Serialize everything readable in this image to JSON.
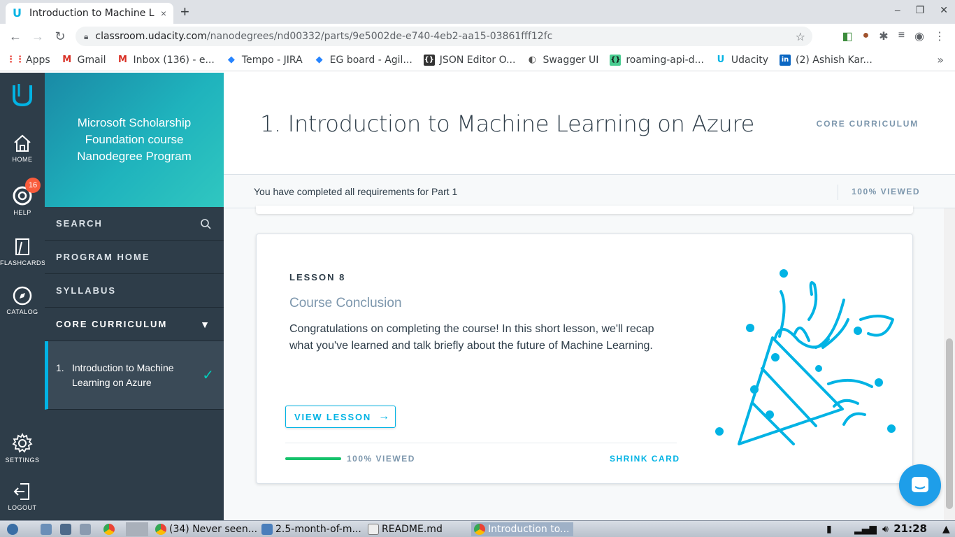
{
  "browser": {
    "tab_title": "Introduction to Machine L",
    "tab_close": "×",
    "new_tab": "+",
    "url_host": "classroom.udacity.com",
    "url_path": "/nanodegrees/nd00332/parts/9e5002de-e740-4eb2-aa15-03861fff12fc",
    "window_controls": [
      "–",
      "❐",
      "✕"
    ]
  },
  "bookmarks": [
    {
      "label": "Apps",
      "icon": "apps-grid-icon",
      "color": "#e8453c"
    },
    {
      "label": "Gmail",
      "icon": "gmail-icon",
      "color": "#d93025"
    },
    {
      "label": "Inbox (136) - e...",
      "icon": "gmail-icon",
      "color": "#d93025"
    },
    {
      "label": "Tempo - JIRA",
      "icon": "jira-icon",
      "color": "#2684ff"
    },
    {
      "label": "EG board - Agil...",
      "icon": "jira-icon",
      "color": "#2684ff"
    },
    {
      "label": "JSON Editor O...",
      "icon": "json-icon",
      "color": "#333333"
    },
    {
      "label": "Swagger UI",
      "icon": "swagger-icon",
      "color": "#555555"
    },
    {
      "label": "roaming-api-d...",
      "icon": "swagger-green-icon",
      "color": "#49cc90"
    },
    {
      "label": "Udacity",
      "icon": "udacity-icon",
      "color": "#02b3e4"
    },
    {
      "label": "(2) Ashish Kar...",
      "icon": "linkedin-icon",
      "color": "#0a66c2"
    }
  ],
  "rail": {
    "home": "HOME",
    "help": "HELP",
    "help_badge": "16",
    "flashcards": "FLASHCARDS",
    "catalog": "CATALOG",
    "settings": "SETTINGS",
    "logout": "LOGOUT"
  },
  "sidebar": {
    "program_title": "Microsoft Scholarship Foundation course Nanodegree Program",
    "search": "SEARCH",
    "program_home": "PROGRAM HOME",
    "syllabus": "SYLLABUS",
    "core_curriculum": "CORE CURRICULUM",
    "active_item_num": "1.",
    "active_item": "Introduction to Machine Learning on Azure"
  },
  "main": {
    "title": "1. Introduction to Machine Learning on Azure",
    "header_tag": "CORE CURRICULUM",
    "status_text": "You have completed all requirements for Part 1",
    "status_progress": "100% VIEWED"
  },
  "lesson": {
    "number": "LESSON 8",
    "title": "Course Conclusion",
    "description": "Congratulations on completing the course! In this short lesson, we'll recap what you've learned and talk briefly about the future of Machine Learning.",
    "view_button": "VIEW LESSON",
    "progress_fraction": 1.0,
    "progress_label": "100% VIEWED",
    "shrink": "SHRINK CARD"
  },
  "colors": {
    "udacity_blue": "#02b3e4",
    "dark_navy": "#2e3d49",
    "progress_green": "#15c26b"
  },
  "taskbar": {
    "items": [
      "(34) Never seen...",
      "2.5-month-of-m...",
      "README.md",
      "Introduction to..."
    ],
    "clock": "21:28"
  }
}
